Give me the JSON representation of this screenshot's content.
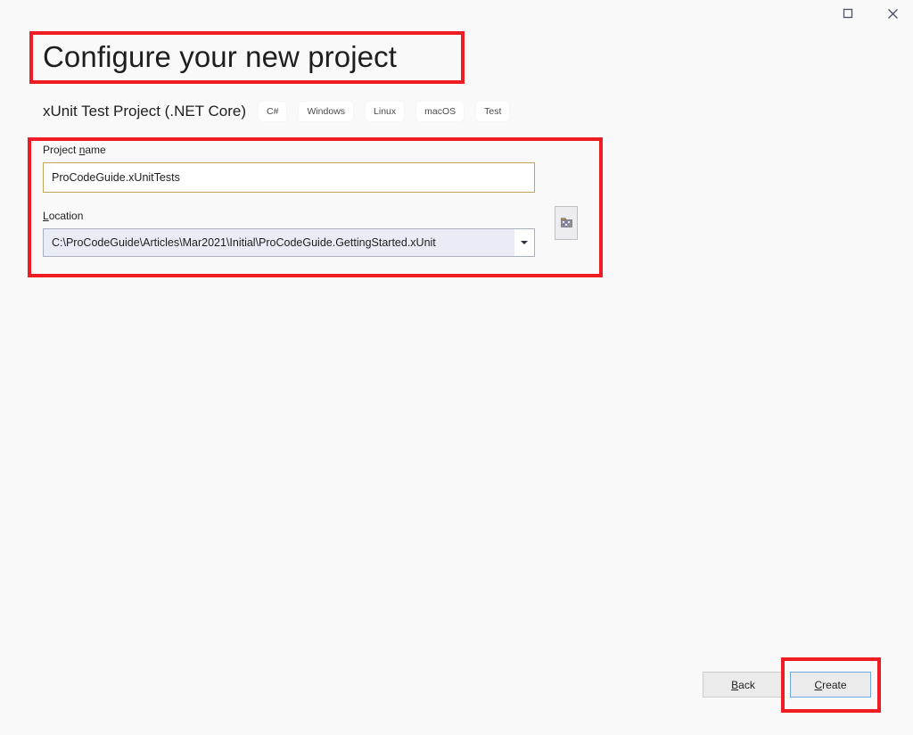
{
  "window": {
    "controls": [
      {
        "name": "maximize",
        "label": "Maximize",
        "glyph": "square"
      },
      {
        "name": "close",
        "label": "Close",
        "glyph": "x"
      }
    ]
  },
  "header": {
    "title": "Configure your new project",
    "template_name": "xUnit Test Project (.NET Core)",
    "tags": [
      "C#",
      "Windows",
      "Linux",
      "macOS",
      "Test"
    ]
  },
  "form": {
    "project_name": {
      "label_before": "Project ",
      "label_accesskey": "n",
      "label_after": "ame",
      "label_full": "Project name",
      "value": "ProCodeGuide.xUnitTests",
      "placeholder": ""
    },
    "location": {
      "label_before": "",
      "label_accesskey": "L",
      "label_after": "ocation",
      "label_full": "Location",
      "value": "C:\\ProCodeGuide\\Articles\\Mar2021\\Initial\\ProCodeGuide.GettingStarted.xUnit",
      "placeholder": "",
      "dropdown_icon": "chevron-down-icon",
      "browse_button_label": "...",
      "browse_icon": "folder-browse-icon"
    }
  },
  "footer": {
    "back": {
      "label_full": "Back",
      "accesskey": "B",
      "label_after": "ack"
    },
    "create": {
      "label_full": "Create",
      "accesskey": "C",
      "label_after": "reate"
    }
  },
  "annotations": {
    "accent_color": "#ee1c25",
    "focus_border_color": "#6fa9e0",
    "input_focus_border_color": "#c5a45a",
    "boxes": [
      "page-title",
      "form-fields",
      "create-button"
    ]
  }
}
